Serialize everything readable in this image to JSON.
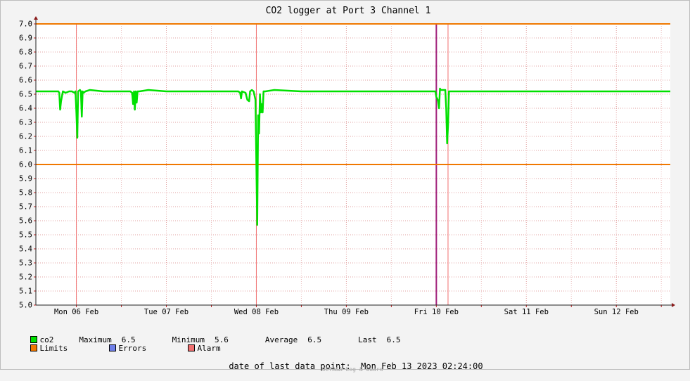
{
  "chart_data": {
    "type": "line",
    "title": "CO2 logger at Port 3 Channel 1",
    "xlabel": "",
    "ylabel": "",
    "ylim": [
      5.0,
      7.0
    ],
    "y_ticks": [
      "7.0",
      "6.9",
      "6.8",
      "6.7",
      "6.6",
      "6.5",
      "6.4",
      "6.3",
      "6.2",
      "6.1",
      "6.0",
      "5.9",
      "5.8",
      "5.7",
      "5.6",
      "5.5",
      "5.4",
      "5.3",
      "5.2",
      "5.1",
      "5.0"
    ],
    "x_ticks": [
      "Mon 06 Feb",
      "Tue 07 Feb",
      "Wed 08 Feb",
      "Thu 09 Feb",
      "Fri 10 Feb",
      "Sat 11 Feb",
      "Sun 12 Feb"
    ],
    "xlim": [
      -0.45,
      6.6
    ],
    "grid": true,
    "limits": [
      7.0,
      6.0
    ],
    "alarm_markers": [
      0.0,
      2.0,
      4.13
    ],
    "error_markers": [
      4.0
    ],
    "series": [
      {
        "name": "co2",
        "color": "#00e000",
        "x": [
          -0.45,
          -0.3,
          -0.2,
          -0.19,
          -0.18,
          -0.17,
          -0.15,
          -0.12,
          -0.08,
          -0.05,
          -0.02,
          -0.01,
          0.0,
          0.01,
          0.02,
          0.04,
          0.05,
          0.06,
          0.07,
          0.08,
          0.1,
          0.15,
          0.3,
          0.5,
          0.6,
          0.62,
          0.63,
          0.64,
          0.65,
          0.66,
          0.67,
          0.68,
          0.7,
          0.8,
          1.0,
          1.2,
          1.5,
          1.7,
          1.8,
          1.82,
          1.83,
          1.84,
          1.88,
          1.9,
          1.92,
          1.93,
          1.95,
          1.97,
          1.99,
          2.0,
          2.01,
          2.02,
          2.03,
          2.04,
          2.05,
          2.06,
          2.07,
          2.08,
          2.1,
          2.2,
          2.5,
          3.0,
          3.5,
          3.9,
          3.99,
          4.0,
          4.01,
          4.02,
          4.03,
          4.04,
          4.05,
          4.06,
          4.08,
          4.1,
          4.11,
          4.12,
          4.13,
          4.14,
          4.15,
          4.16,
          4.18,
          4.3,
          4.6,
          5.0,
          5.5,
          6.0,
          6.3,
          6.6
        ],
        "values": [
          6.52,
          6.52,
          6.52,
          6.51,
          6.39,
          6.45,
          6.52,
          6.51,
          6.52,
          6.52,
          6.51,
          6.52,
          6.37,
          6.19,
          6.52,
          6.53,
          6.52,
          6.34,
          6.52,
          6.51,
          6.52,
          6.53,
          6.52,
          6.52,
          6.52,
          6.51,
          6.43,
          6.52,
          6.39,
          6.52,
          6.44,
          6.52,
          6.52,
          6.53,
          6.52,
          6.52,
          6.52,
          6.52,
          6.52,
          6.51,
          6.47,
          6.52,
          6.51,
          6.46,
          6.45,
          6.52,
          6.53,
          6.52,
          6.46,
          6.0,
          5.57,
          6.35,
          6.22,
          6.5,
          6.37,
          6.43,
          6.37,
          6.52,
          6.52,
          6.53,
          6.52,
          6.52,
          6.52,
          6.52,
          6.52,
          6.48,
          6.47,
          6.45,
          6.4,
          6.54,
          6.53,
          6.53,
          6.53,
          6.53,
          6.4,
          6.15,
          6.28,
          6.52,
          6.52,
          6.52,
          6.52,
          6.52,
          6.52,
          6.52,
          6.52,
          6.52,
          6.52,
          6.52
        ]
      }
    ],
    "limits_color": "#f07800",
    "errors_color": "#6f7fe8",
    "alarm_color": "#f07070",
    "error_marker_color": "#a0207a"
  },
  "legend": {
    "series_name": "co2",
    "maximum_label": "Maximum",
    "maximum_value": "6.5",
    "minimum_label": "Minimum",
    "minimum_value": "5.6",
    "average_label": "Average",
    "average_value": "6.5",
    "last_label": "Last",
    "last_value": "6.5",
    "limits_label": "Limits",
    "errors_label": "Errors",
    "alarm_label": "Alarm"
  },
  "footer": {
    "last_point_label": "date of last data point:",
    "last_point_value": "Mon Feb 13 2023 02:24:00",
    "watermark": "OCTA&A Log & Guard"
  }
}
